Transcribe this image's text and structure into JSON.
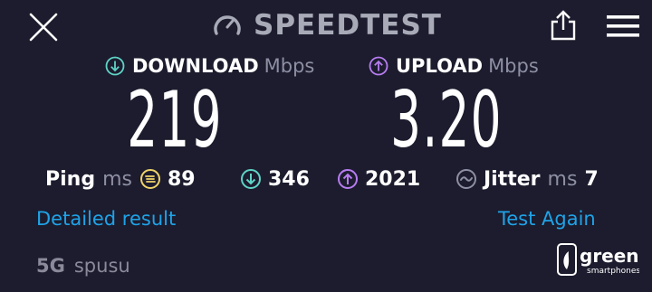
{
  "header": {
    "title": "SPEEDTEST"
  },
  "download": {
    "label": "DOWNLOAD",
    "unit": "Mbps",
    "value": "219"
  },
  "upload": {
    "label": "UPLOAD",
    "unit": "Mbps",
    "value": "3.20"
  },
  "ping": {
    "label": "Ping",
    "unit": "ms",
    "idle": "89",
    "download": "346",
    "upload": "2021"
  },
  "jitter": {
    "label": "Jitter",
    "unit": "ms",
    "value": "7"
  },
  "links": {
    "detailed": "Detailed result",
    "again": "Test Again"
  },
  "network": {
    "type": "5G",
    "provider": "spusu"
  },
  "watermark": {
    "word": "green",
    "sub": "smartphones"
  },
  "colors": {
    "background": "#1c1c2e",
    "download": "#5fd3c6",
    "upload": "#b77cf0",
    "ping": "#f0d46a",
    "link": "#1fa3e8"
  }
}
